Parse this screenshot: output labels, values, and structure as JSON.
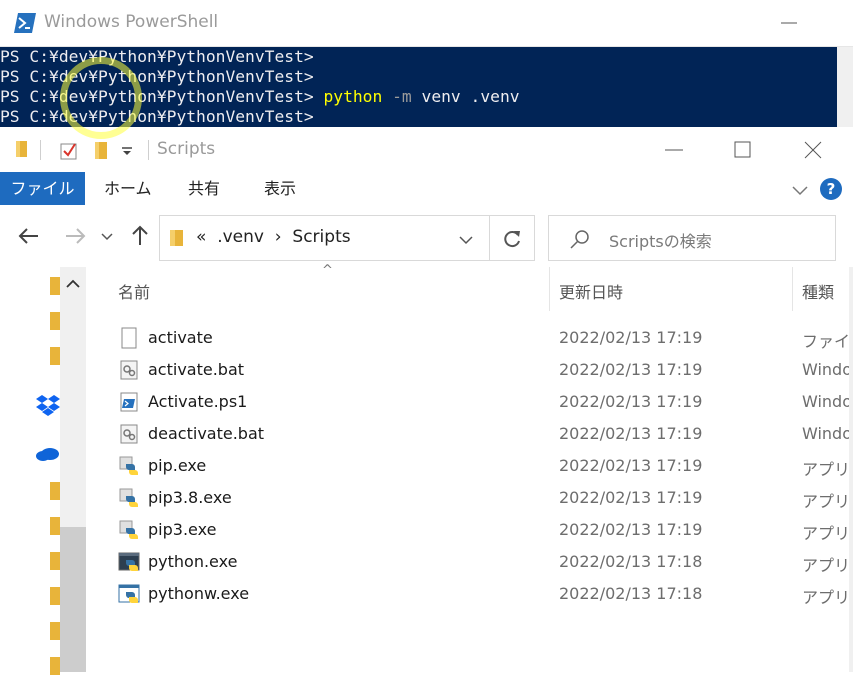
{
  "powershell": {
    "title": "Windows PowerShell",
    "lines": [
      {
        "prompt": "PS C:¥dev¥Python¥PythonVenvTest>",
        "cmd": "",
        "param": "",
        "args": ""
      },
      {
        "prompt": "PS C:¥dev¥Python¥PythonVenvTest>",
        "cmd": "",
        "param": "",
        "args": ""
      },
      {
        "prompt": "PS C:¥dev¥Python¥PythonVenvTest>",
        "cmd": " python",
        "param": " -m",
        "args": " venv .venv"
      },
      {
        "prompt": "PS C:¥dev¥Python¥PythonVenvTest>",
        "cmd": "",
        "param": "",
        "args": ""
      }
    ],
    "colors": {
      "background": "#012456",
      "command": "#ffff00",
      "parameter": "#9b9b9b",
      "text": "#eeedf0"
    }
  },
  "explorer": {
    "title": "Scripts",
    "ribbon": {
      "file": "ファイル",
      "home": "ホーム",
      "share": "共有",
      "view": "表示",
      "help": "?"
    },
    "address": {
      "overflow": "«",
      "parent": ".venv",
      "separator": "›",
      "current": "Scripts"
    },
    "search": {
      "placeholder": "Scriptsの検索"
    },
    "columns": {
      "name": "名前",
      "date": "更新日時",
      "type": "種類"
    },
    "files": [
      {
        "name": "activate",
        "date": "2022/02/13 17:19",
        "type": "ファイル",
        "icon": "blank-file-icon"
      },
      {
        "name": "activate.bat",
        "date": "2022/02/13 17:19",
        "type": "Windo",
        "icon": "batch-file-icon"
      },
      {
        "name": "Activate.ps1",
        "date": "2022/02/13 17:19",
        "type": "Windo",
        "icon": "powershell-script-icon"
      },
      {
        "name": "deactivate.bat",
        "date": "2022/02/13 17:19",
        "type": "Windo",
        "icon": "batch-file-icon"
      },
      {
        "name": "pip.exe",
        "date": "2022/02/13 17:19",
        "type": "アプリケ",
        "icon": "python-exe-icon"
      },
      {
        "name": "pip3.8.exe",
        "date": "2022/02/13 17:19",
        "type": "アプリケ",
        "icon": "python-exe-icon"
      },
      {
        "name": "pip3.exe",
        "date": "2022/02/13 17:19",
        "type": "アプリケ",
        "icon": "python-exe-icon"
      },
      {
        "name": "python.exe",
        "date": "2022/02/13 17:18",
        "type": "アプリケ",
        "icon": "python-console-icon"
      },
      {
        "name": "pythonw.exe",
        "date": "2022/02/13 17:18",
        "type": "アプリケ",
        "icon": "python-window-icon"
      }
    ],
    "colors": {
      "accent": "#1e6bbf",
      "folder": "#e8b43a"
    }
  }
}
